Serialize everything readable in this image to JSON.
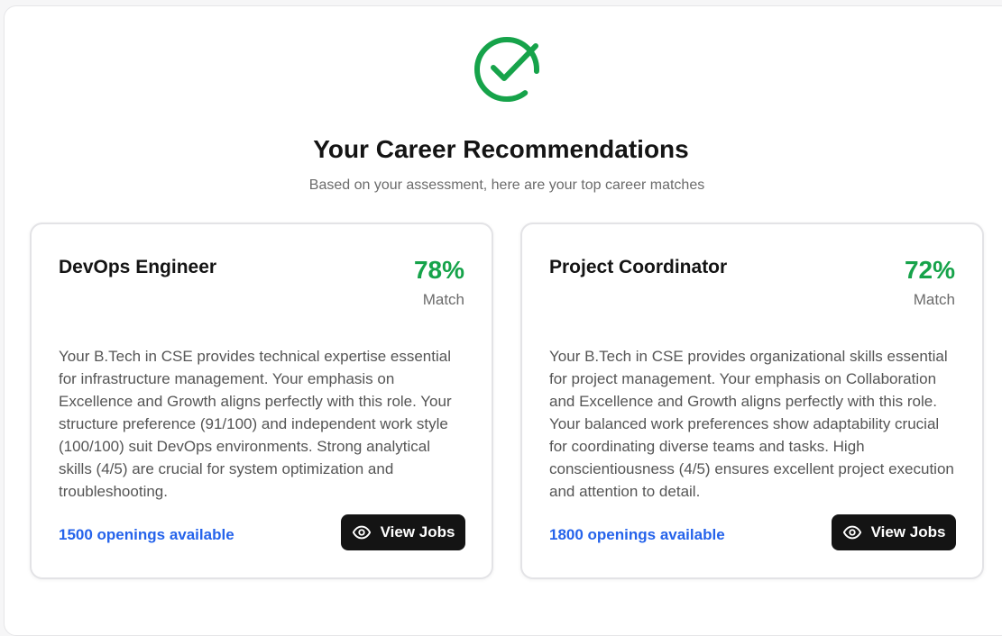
{
  "header": {
    "icon": "check-circle-icon",
    "title": "Your Career Recommendations",
    "subtitle": "Based on your assessment, here are your top career matches",
    "accent_color": "#16a34a"
  },
  "cards": [
    {
      "role": "DevOps Engineer",
      "match_percent": "78%",
      "match_label": "Match",
      "description": "Your B.Tech in CSE provides technical expertise essential for infrastructure management. Your emphasis on Excellence and Growth aligns perfectly with this role. Your structure preference (91/100) and independent work style (100/100) suit DevOps environments. Strong analytical skills (4/5) are crucial for system optimization and troubleshooting.",
      "openings": "1500 openings available",
      "button_label": "View Jobs",
      "button_icon": "eye-icon"
    },
    {
      "role": "Project Coordinator",
      "match_percent": "72%",
      "match_label": "Match",
      "description": "Your B.Tech in CSE provides organizational skills essential for project management. Your emphasis on Collaboration and Excellence and Growth aligns perfectly with this role. Your balanced work preferences show adaptability crucial for coordinating diverse teams and tasks. High conscientiousness (4/5) ensures excellent project execution and attention to detail.",
      "openings": "1800 openings available",
      "button_label": "View Jobs",
      "button_icon": "eye-icon"
    }
  ]
}
